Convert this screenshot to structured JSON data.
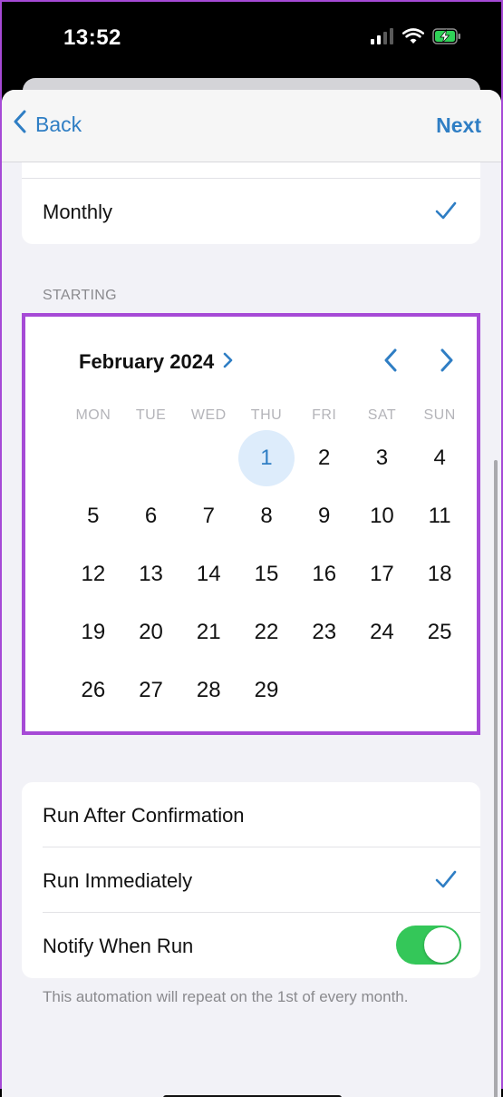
{
  "status": {
    "time": "13:52"
  },
  "nav": {
    "back_label": "Back",
    "next_label": "Next"
  },
  "frequency": {
    "selected_label": "Monthly"
  },
  "starting": {
    "section_label": "STARTING",
    "month_label": "February 2024",
    "weekdays": [
      "MON",
      "TUE",
      "WED",
      "THU",
      "FRI",
      "SAT",
      "SUN"
    ],
    "days": [
      "",
      "",
      "",
      "1",
      "2",
      "3",
      "4",
      "5",
      "6",
      "7",
      "8",
      "9",
      "10",
      "11",
      "12",
      "13",
      "14",
      "15",
      "16",
      "17",
      "18",
      "19",
      "20",
      "21",
      "22",
      "23",
      "24",
      "25",
      "26",
      "27",
      "28",
      "29"
    ],
    "selected_day": "1"
  },
  "options": {
    "run_after_confirmation": "Run After Confirmation",
    "run_immediately": "Run Immediately",
    "notify_when_run": "Notify When Run",
    "notify_enabled": true,
    "selected": "Run Immediately"
  },
  "footer_note": "This automation will repeat on the 1st of every month.",
  "colors": {
    "accent": "#2f7ec4",
    "toggle_on": "#34c759",
    "highlight_border": "#a64ad6",
    "selected_day_bg": "#ddecfb"
  }
}
